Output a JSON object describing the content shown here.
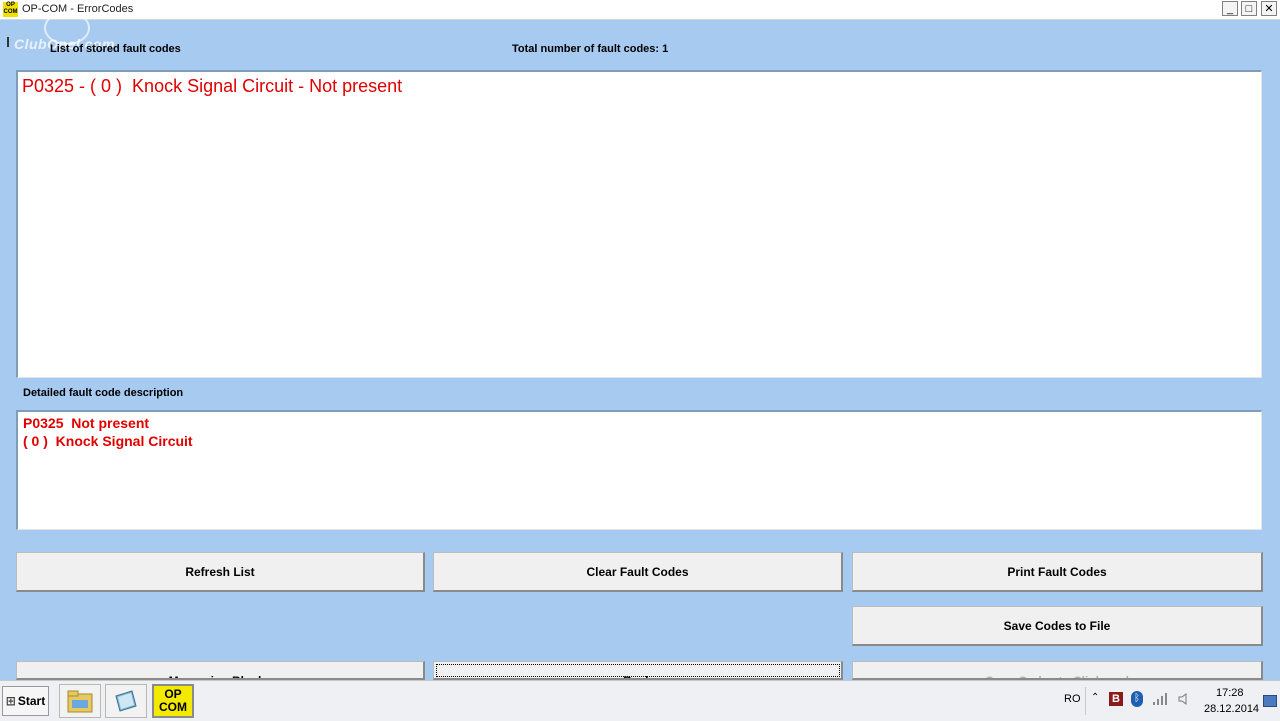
{
  "window": {
    "title": "OP-COM - ErrorCodes",
    "icon_text": "OP COM",
    "controls": {
      "minimize": "_",
      "maximize": "□",
      "close": "✕"
    }
  },
  "watermark": "ClubOpel.com",
  "list_section": {
    "label": "List of stored fault codes",
    "total_label": "Total number of fault codes:",
    "total_value": "1",
    "codes": [
      "P0325 - ( 0 )  Knock Signal Circuit - Not present"
    ]
  },
  "description_section": {
    "label": "Detailed fault code description",
    "lines": [
      "P0325  Not present",
      "( 0 )  Knock Signal Circuit"
    ]
  },
  "buttons": {
    "refresh": "Refresh List",
    "clear": "Clear Fault Codes",
    "print": "Print Fault Codes",
    "save": "Save Codes to File",
    "measuring_blocks": "Measuring Blocks",
    "back": "Back",
    "copy_clipboard": "Copy Codes to Clipboard"
  },
  "taskbar": {
    "start_label": "Start",
    "opcom_task_label": "OP COM",
    "language": "RO",
    "time": "17:28",
    "date": "28.12.2014"
  },
  "colors": {
    "background": "#a6caf0",
    "fault_text": "#e00000",
    "opcom_yellow": "#f4e900"
  }
}
